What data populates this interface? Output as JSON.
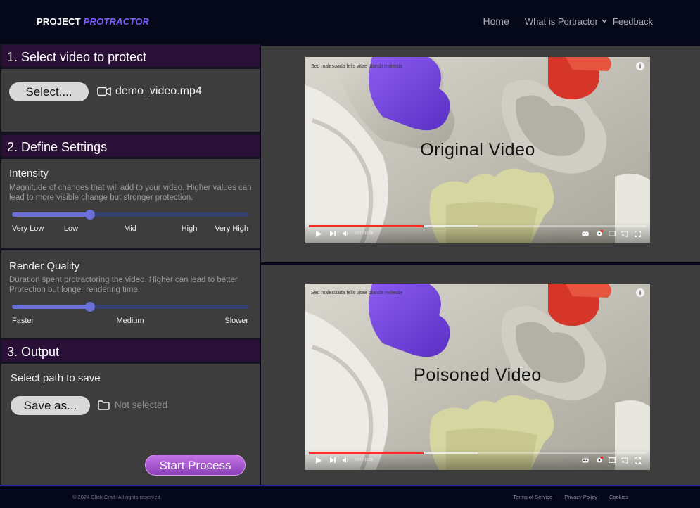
{
  "header": {
    "brand_prefix": "PROJECT",
    "brand_accent": "PROTRACTOR",
    "nav": {
      "home": "Home",
      "what": "What is Portractor",
      "feedback": "Feedback"
    }
  },
  "sections": {
    "select": {
      "title": "1. Select video to protect",
      "button": "Select....",
      "filename": "demo_video.mp4",
      "file_icon": "video-camera-icon"
    },
    "settings": {
      "title": "2. Define Settings",
      "intensity": {
        "label": "Intensity",
        "description": "Magnitude of changes that will add to your video. Higher values can lead to more visible change but stronger protection.",
        "value": 0.33,
        "ticks": [
          "Very Low",
          "Low",
          "Mid",
          "High",
          "Very High"
        ]
      },
      "quality": {
        "label": "Render Quality",
        "description": "Duration spent protractoring the video. Higher can lead to better Protection but longer rendering time.",
        "value": 0.33,
        "ticks": [
          "Faster",
          "Medium",
          "Slower"
        ]
      }
    },
    "output": {
      "title": "3. Output",
      "path_label": "Select path to save",
      "button": "Save as...",
      "folder_status": "Not selected",
      "folder_icon": "folder-icon",
      "start": "Start Process"
    }
  },
  "videos": [
    {
      "title": "Original Video",
      "caption": "Sed malesuada felis vitae blandit molestie",
      "time": "0:07 / 15:28",
      "played": 0.34,
      "buffered": 0.5
    },
    {
      "title": "Poisoned Video",
      "caption": "Sed malesuada felis vitae blandit molestie",
      "time": "0:07 / 15:28",
      "played": 0.34,
      "buffered": 0.5
    }
  ],
  "footer": {
    "copyright": "© 2024 Click Craft. All rights reserved.",
    "links": [
      "Terms of Service",
      "Privacy Policy",
      "Cookies"
    ]
  },
  "colors": {
    "header_bg": "#050818",
    "section_header_bg": "#2a0f36",
    "panel_bg": "#3d3d3d",
    "brand_accent": "#7c5cff",
    "slider_fill": "#6b6fd8",
    "slider_track": "#34406e",
    "progress_red": "#ff2a2a",
    "start_button": "#b05fd9"
  }
}
